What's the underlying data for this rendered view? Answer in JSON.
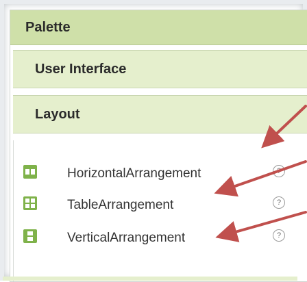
{
  "palette": {
    "title": "Palette",
    "categories": [
      {
        "label": "User Interface"
      },
      {
        "label": "Layout"
      }
    ],
    "items": [
      {
        "label": "HorizontalArrangement",
        "icon": "horizontal-arrangement-icon",
        "help": "?"
      },
      {
        "label": "TableArrangement",
        "icon": "table-arrangement-icon",
        "help": "?"
      },
      {
        "label": "VerticalArrangement",
        "icon": "vertical-arrangement-icon",
        "help": "?"
      }
    ]
  },
  "colors": {
    "header": "#cfe0a9",
    "category": "#e5efcd",
    "icon_green": "#7fb24a",
    "arrow": "#c0504d"
  }
}
